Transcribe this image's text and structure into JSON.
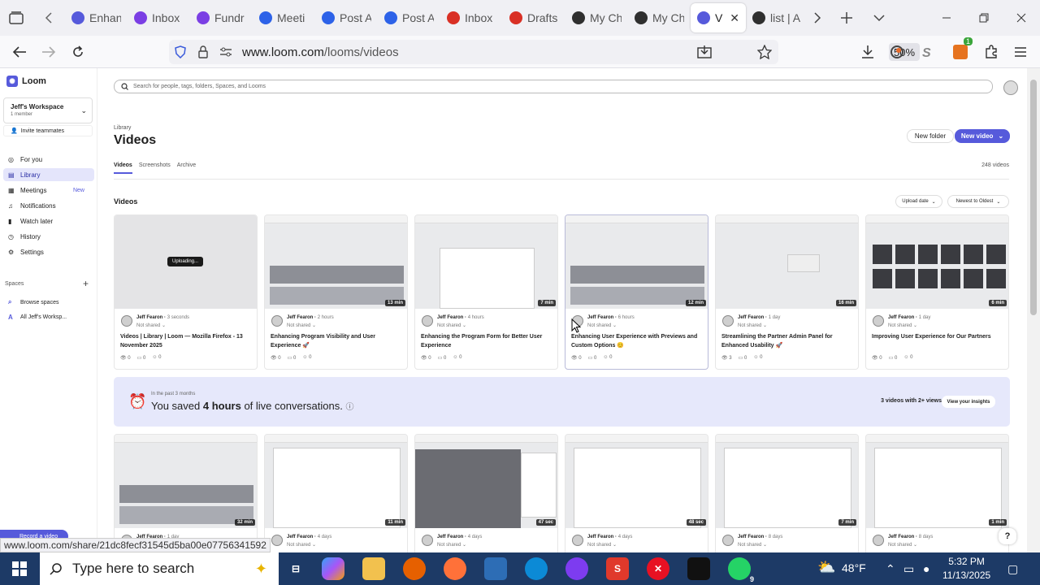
{
  "browser": {
    "tabs": [
      {
        "label": "Enhan",
        "icon": "loom-icon",
        "color": "#565adb"
      },
      {
        "label": "Inbox",
        "icon": "clickup-icon",
        "color": "#7b3fe4"
      },
      {
        "label": "Fundr",
        "icon": "clickup-icon",
        "color": "#7b3fe4"
      },
      {
        "label": "Meeti",
        "icon": "zoom-icon",
        "color": "#2d62e8"
      },
      {
        "label": "Post A",
        "icon": "zoom-icon",
        "color": "#2d62e8"
      },
      {
        "label": "Post A",
        "icon": "zoom-icon",
        "color": "#2d62e8"
      },
      {
        "label": "Inbox",
        "icon": "gmail-icon",
        "color": "#d93025"
      },
      {
        "label": "Drafts",
        "icon": "gmail-icon",
        "color": "#d93025"
      },
      {
        "label": "My Ch",
        "icon": "chatgpt-icon",
        "color": "#2f2f2f"
      },
      {
        "label": "My Ch",
        "icon": "chatgpt-icon",
        "color": "#2f2f2f"
      },
      {
        "label": "Vid",
        "icon": "loom-icon",
        "color": "#565adb",
        "active": true
      },
      {
        "label": "list | A",
        "icon": "chatgpt-icon",
        "color": "#2f2f2f"
      }
    ],
    "url_host": "www.loom.com",
    "url_path": "/looms/videos",
    "zoom": "50%",
    "status_url": "www.loom.com/share/21dc8fecf31545d5ba00e07756341592"
  },
  "sidebar": {
    "brand": "Loom",
    "workspace_name": "Jeff's Workspace",
    "workspace_members": "1 member",
    "invite_label": "Invite teammates",
    "items": [
      {
        "label": "For you",
        "icon": "compass-icon"
      },
      {
        "label": "Library",
        "icon": "library-icon",
        "active": true
      },
      {
        "label": "Meetings",
        "icon": "calendar-icon",
        "badge": "New"
      },
      {
        "label": "Notifications",
        "icon": "bell-icon"
      },
      {
        "label": "Watch later",
        "icon": "bookmark-icon"
      },
      {
        "label": "History",
        "icon": "clock-icon"
      },
      {
        "label": "Settings",
        "icon": "gear-icon"
      }
    ],
    "spaces_heading": "Spaces",
    "spaces": [
      {
        "label": "Browse spaces",
        "icon": "search-icon"
      },
      {
        "label": "All Jeff's Worksp...",
        "icon": "space-a-icon"
      }
    ],
    "record_label": "Record a video"
  },
  "main": {
    "search_placeholder": "Search for people, tags, folders, Spaces, and Looms",
    "breadcrumb": "Library",
    "title": "Videos",
    "new_folder": "New folder",
    "new_video": "New video",
    "subtabs": [
      "Videos",
      "Screenshots",
      "Archive"
    ],
    "video_count": "248 videos",
    "section_title": "Videos",
    "sort_field": "Upload date",
    "sort_order": "Newest to Oldest",
    "uploading_label": "Uploading...",
    "cards": [
      {
        "author": "Jeff Fearon",
        "ago": "3 seconds",
        "share": "Not shared",
        "title": "Videos | Library | Loom — Mozilla Firefox - 13 November 2025",
        "duration": "",
        "views": "0",
        "comments": "0",
        "reactions": "0"
      },
      {
        "author": "Jeff Fearon",
        "ago": "2 hours",
        "share": "Not shared",
        "title": "Enhancing Program Visibility and User Experience 🚀",
        "duration": "13 min",
        "views": "0",
        "comments": "0",
        "reactions": "0"
      },
      {
        "author": "Jeff Fearon",
        "ago": "4 hours",
        "share": "Not shared",
        "title": "Enhancing the Program Form for Better User Experience",
        "duration": "7 min",
        "views": "0",
        "comments": "0",
        "reactions": "0"
      },
      {
        "author": "Jeff Fearon",
        "ago": "6 hours",
        "share": "Not shared",
        "title": "Enhancing User Experience with Previews and Custom Options 😊",
        "duration": "12 min",
        "views": "0",
        "comments": "0",
        "reactions": "0"
      },
      {
        "author": "Jeff Fearon",
        "ago": "1 day",
        "share": "Not shared",
        "title": "Streamlining the Partner Admin Panel for Enhanced Usability 🚀",
        "duration": "16 min",
        "views": "3",
        "comments": "0",
        "reactions": "0"
      },
      {
        "author": "Jeff Fearon",
        "ago": "1 day",
        "share": "Not shared",
        "title": "Improving User Experience for Our Partners",
        "duration": "6 min",
        "views": "0",
        "comments": "0",
        "reactions": "0"
      }
    ],
    "insights": {
      "period": "In the past 3 months",
      "text_before": "You saved ",
      "hours": "4 hours",
      "text_after": " of live conversations.",
      "count": "3 videos with 2+ views",
      "button": "View your insights"
    },
    "cards2": [
      {
        "author": "Jeff Fearon",
        "ago": "1 day",
        "share": "Not shared",
        "duration": "32 min"
      },
      {
        "author": "Jeff Fearon",
        "ago": "4 days",
        "share": "Not shared",
        "duration": "11 min"
      },
      {
        "author": "Jeff Fearon",
        "ago": "4 days",
        "share": "Not shared",
        "duration": "47 sec"
      },
      {
        "author": "Jeff Fearon",
        "ago": "4 days",
        "share": "Not shared",
        "duration": "48 sec"
      },
      {
        "author": "Jeff Fearon",
        "ago": "8 days",
        "share": "Not shared",
        "duration": "7 min"
      },
      {
        "author": "Jeff Fearon",
        "ago": "8 days",
        "share": "Not shared",
        "duration": "1 min"
      }
    ],
    "help": "?"
  },
  "taskbar": {
    "search_placeholder": "Type here to search",
    "temperature": "48°F",
    "time": "5:32 PM",
    "date": "11/13/2025",
    "whatsapp_badge": "9"
  },
  "colors": {
    "accent": "#565adb",
    "insights_bg": "#e6e8fb",
    "taskbar": "#1d3a66"
  }
}
